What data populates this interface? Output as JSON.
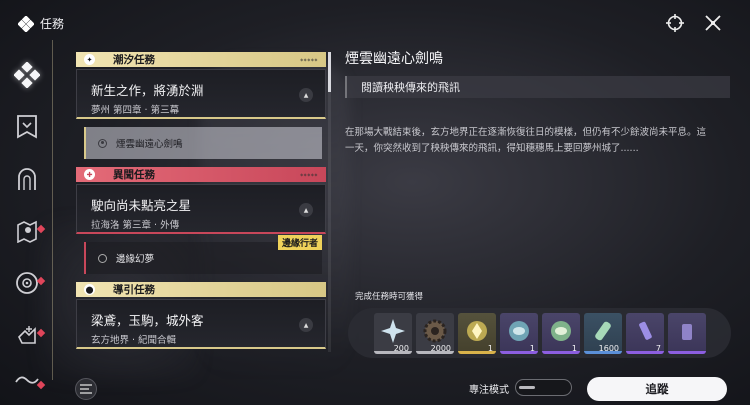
{
  "header": {
    "title": "任務"
  },
  "topbar": {
    "icons": [
      "target-icon",
      "close-icon"
    ]
  },
  "leftnav": {
    "items": [
      {
        "name": "quest-diamond-icon",
        "active": true,
        "dot": false
      },
      {
        "name": "banner-icon",
        "active": false,
        "dot": false
      },
      {
        "name": "arch-icon",
        "active": false,
        "dot": false
      },
      {
        "name": "map-pin-icon",
        "active": false,
        "dot": true
      },
      {
        "name": "compass-icon",
        "active": false,
        "dot": true
      },
      {
        "name": "hand-icon",
        "active": false,
        "dot": true
      },
      {
        "name": "wave-icon",
        "active": false,
        "dot": true
      }
    ]
  },
  "quests": {
    "tide": {
      "category": "潮汐任務",
      "name": "新生之作，將湧於淵",
      "sub": "夢州 第四章 · 第三幕",
      "subquest": "煙雲幽遠心劍鳴"
    },
    "strange": {
      "category": "異聞任務",
      "name": "駛向尚未點亮之星",
      "sub": "拉海洛 第三章 · 外傳",
      "subquest": "邊緣幻夢",
      "tag": "邊緣行者"
    },
    "guide": {
      "category": "導引任務",
      "name": "梁鳶，玉駒，城外客",
      "sub": "玄方地界 · 紀聞合輯"
    }
  },
  "detail": {
    "title": "煙雲幽遠心劍鳴",
    "objective": "閱讀秧秧傳來的飛訊",
    "description": "在那場大戰結束後，玄方地界正在逐漸恢復往日的模樣，但仍有不少餘波尚未平息。這一天，你突然收到了秧秧傳來的飛訊，得知穗穗馬上要回夢州城了......"
  },
  "rewards": {
    "label": "完成任務時可獲得",
    "items": [
      {
        "name": "star-shard-icon",
        "count": "200",
        "rarity": "gray"
      },
      {
        "name": "gear-coin-icon",
        "count": "2000",
        "rarity": "gray"
      },
      {
        "name": "gold-crystal-icon",
        "count": "1",
        "rarity": "gold"
      },
      {
        "name": "echo-orb-icon",
        "count": "1",
        "rarity": "purple"
      },
      {
        "name": "echo-orb-green-icon",
        "count": "1",
        "rarity": "purple"
      },
      {
        "name": "exp-potion-icon",
        "count": "1600",
        "rarity": "blue"
      },
      {
        "name": "bottle-icon",
        "count": "7",
        "rarity": "purple"
      },
      {
        "name": "partial-item-icon",
        "count": "",
        "rarity": "purple"
      }
    ]
  },
  "footer": {
    "focus_label": "專注模式",
    "track_label": "追蹤"
  },
  "colors": {
    "tide_accent": "#d8c98a",
    "strange_accent": "#c8475a",
    "tag_yellow": "#efd25a"
  }
}
